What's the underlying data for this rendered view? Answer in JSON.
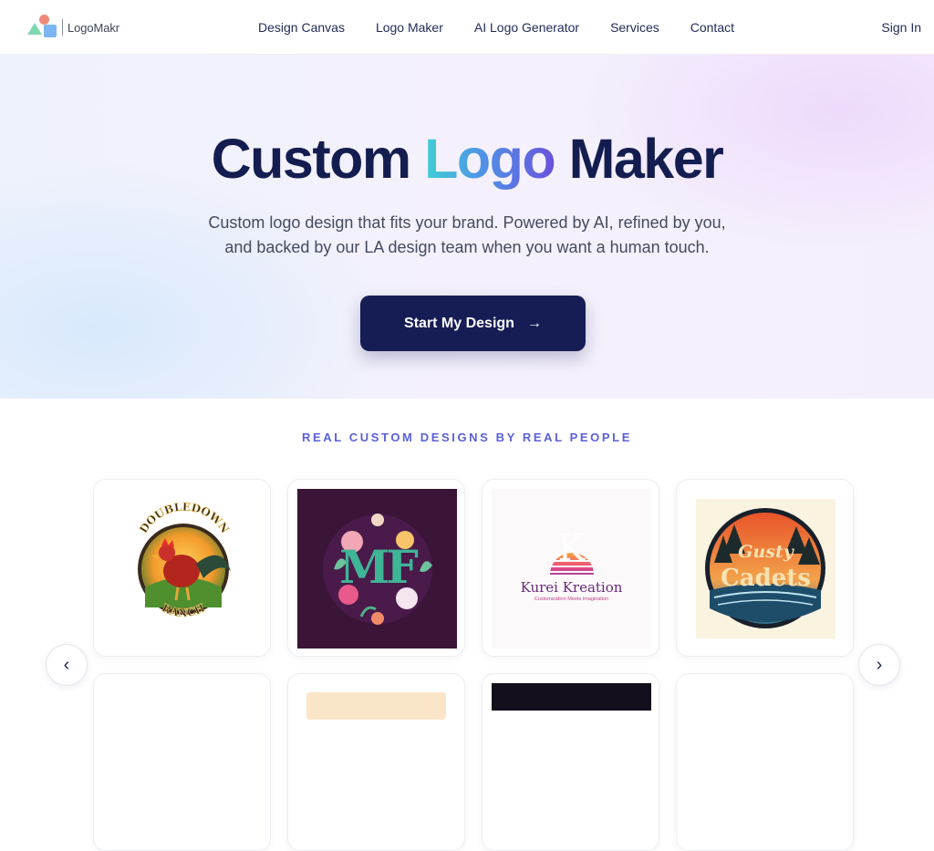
{
  "nav": {
    "brand": "LogoMakr",
    "links": [
      "Design Canvas",
      "Logo Maker",
      "AI Logo Generator",
      "Services",
      "Contact"
    ],
    "sign_in": "Sign In"
  },
  "hero": {
    "title_part1": "Custom ",
    "title_highlight": "Logo",
    "title_part2": " Maker",
    "subtitle_line1": "Custom logo design that fits your brand. Powered by AI, refined by you,",
    "subtitle_line2": "and backed by our LA design team when you want a human touch.",
    "cta_label": "Start My Design",
    "cta_arrow": "→"
  },
  "showcase": {
    "eyebrow": "REAL CUSTOM DESIGNS BY REAL PEOPLE",
    "cards": [
      {
        "top_text": "DOUBLEDOWN",
        "bottom_text": "RANCH"
      },
      {
        "monogram": "MF"
      },
      {
        "mark": "K",
        "name": "Kurei Kreation",
        "tagline": "Customization Meets Imagination"
      },
      {
        "line1": "Gusty",
        "line2": "Cadets"
      }
    ],
    "prev_icon": "‹",
    "next_icon": "›"
  },
  "colors": {
    "navy": "#161d55",
    "title": "#141d4f",
    "accent": "#5b5fd8"
  }
}
